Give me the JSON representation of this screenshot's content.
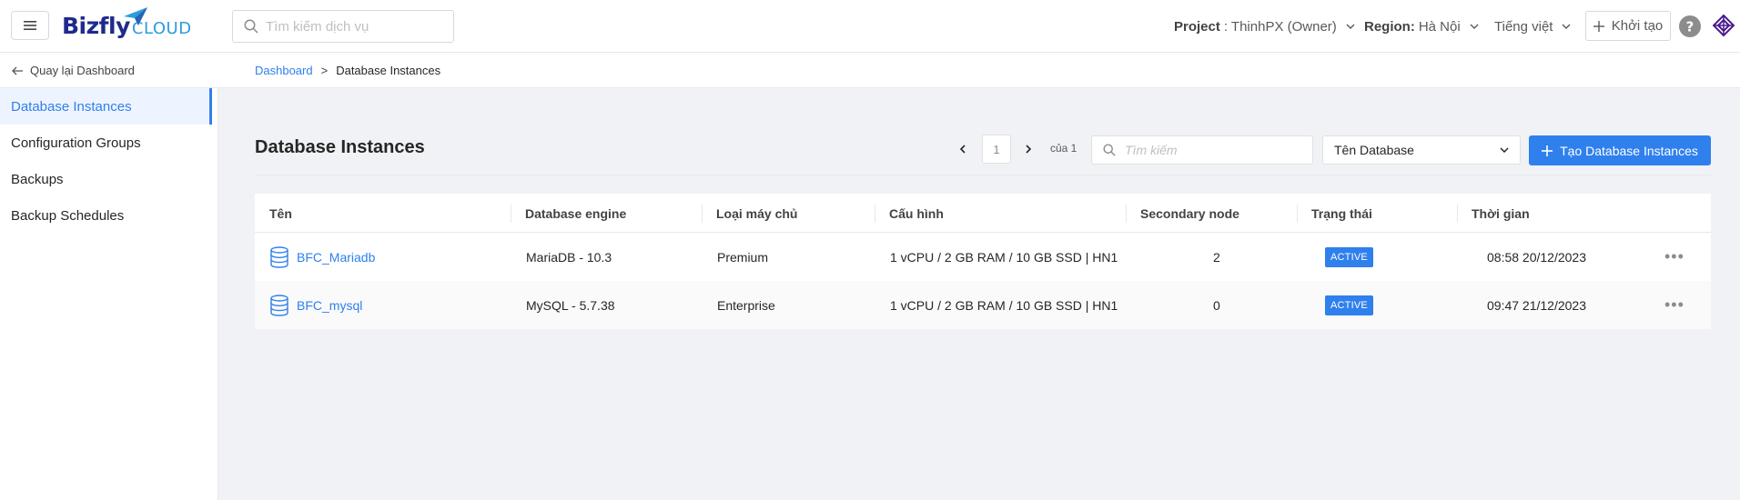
{
  "header": {
    "logo_main": "Bizfly",
    "logo_sub": "CLOUD",
    "search_placeholder": "Tìm kiếm dịch vụ",
    "project_label": "Project",
    "project_value": ": ThinhPX (Owner)",
    "region_label": "Region:",
    "region_value": "Hà Nội",
    "language": "Tiếng việt",
    "create_label": "Khởi tạo"
  },
  "subbar": {
    "back_label": "Quay lại Dashboard",
    "breadcrumb": [
      "Dashboard",
      ">",
      "Database Instances"
    ]
  },
  "sidebar": {
    "items": [
      {
        "label": "Database Instances",
        "active": true
      },
      {
        "label": "Configuration Groups",
        "active": false
      },
      {
        "label": "Backups",
        "active": false
      },
      {
        "label": "Backup Schedules",
        "active": false
      }
    ]
  },
  "main": {
    "title": "Database Instances",
    "pager": {
      "current": "1",
      "of_label": "của 1"
    },
    "search_placeholder": "Tìm kiếm",
    "filter_select": "Tên Database",
    "create_button": "Tạo Database Instances"
  },
  "table": {
    "columns": [
      "Tên",
      "Database engine",
      "Loại máy chủ",
      "Cấu hình",
      "Secondary node",
      "Trạng thái",
      "Thời gian"
    ],
    "rows": [
      {
        "name": "BFC_Mariadb",
        "engine": "MariaDB - 10.3",
        "type": "Premium",
        "config": "1 vCPU / 2 GB RAM / 10 GB SSD | HN1",
        "secondary": "2",
        "status": "ACTIVE",
        "time": "08:58 20/12/2023",
        "more": "•••"
      },
      {
        "name": "BFC_mysql",
        "engine": "MySQL - 5.7.38",
        "type": "Enterprise",
        "config": "1 vCPU / 2 GB RAM / 10 GB SSD | HN1",
        "secondary": "0",
        "status": "ACTIVE",
        "time": "09:47 21/12/2023",
        "more": "•••"
      }
    ]
  },
  "colors": {
    "accent": "#2f80ed",
    "logo_dark": "#1f2a8c",
    "logo_light": "#2d9cdb",
    "app_icon": "#4b1c8c"
  }
}
